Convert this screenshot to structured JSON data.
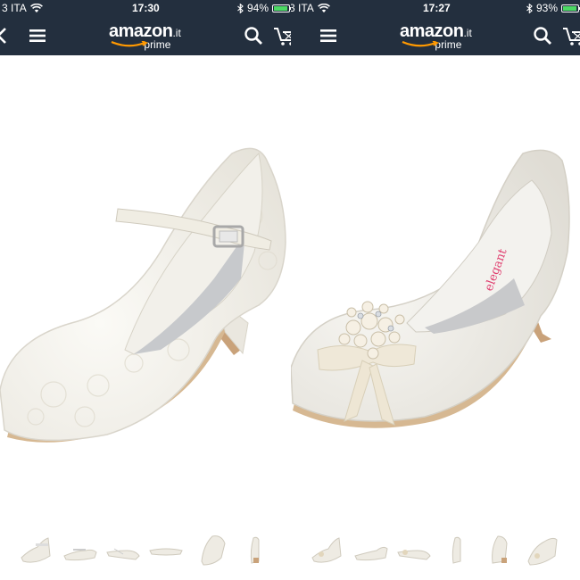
{
  "left_screen": {
    "status": {
      "carrier": "3 ITA",
      "time": "17:30",
      "battery": "94%",
      "battery_level": 0.94
    },
    "nav": {
      "logo_word": "amazon",
      "logo_tld": ".it",
      "logo_prime": "prime"
    },
    "thumbnails": {
      "count": 6,
      "selected_index": 0
    }
  },
  "right_screen": {
    "status": {
      "carrier": "3 ITA",
      "time": "17:27",
      "battery": "93%",
      "battery_level": 0.93
    },
    "nav": {
      "logo_word": "amazon",
      "logo_tld": ".it",
      "logo_prime": "prime"
    },
    "thumbnails": {
      "count": 6,
      "selected_index": 0
    }
  },
  "colors": {
    "header_bg": "#232f3e",
    "battery_green": "#4cd964",
    "amazon_orange": "#ff9900"
  },
  "icons": [
    "back-icon",
    "menu-icon",
    "search-icon",
    "cart-icon",
    "wifi-icon",
    "bluetooth-icon"
  ]
}
